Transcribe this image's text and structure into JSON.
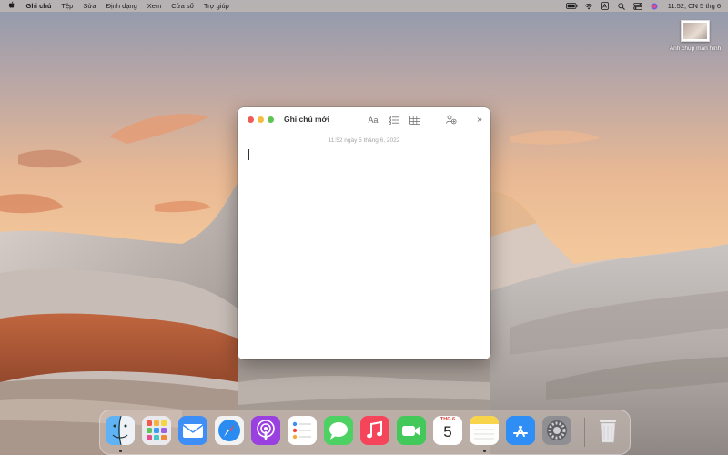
{
  "menubar": {
    "app_name": "Ghi chú",
    "menus": [
      "Tệp",
      "Sửa",
      "Định dạng",
      "Xem",
      "Cửa sổ",
      "Trợ giúp"
    ],
    "clock": "11:52, CN 5 thg 6"
  },
  "desktop": {
    "icon_label": "Ảnh chụp màn hình"
  },
  "window": {
    "title": "Ghi chú mới",
    "font_button": "Aa",
    "more": "»",
    "date": "11:52 ngày 5 tháng 6, 2022"
  },
  "dock": {
    "apps": [
      "Finder",
      "Launchpad",
      "Mail",
      "Safari",
      "Podcasts",
      "Reminders",
      "Messages",
      "Music",
      "FaceTime",
      "Calendar",
      "Notes",
      "App Store",
      "System Preferences",
      "Trash"
    ],
    "calendar_month": "THG 6",
    "calendar_day": "5"
  },
  "colors": {
    "close": "#ee5c54",
    "minimize": "#f4bd42",
    "zoom": "#5fc454",
    "accent": "#e23b2f"
  }
}
